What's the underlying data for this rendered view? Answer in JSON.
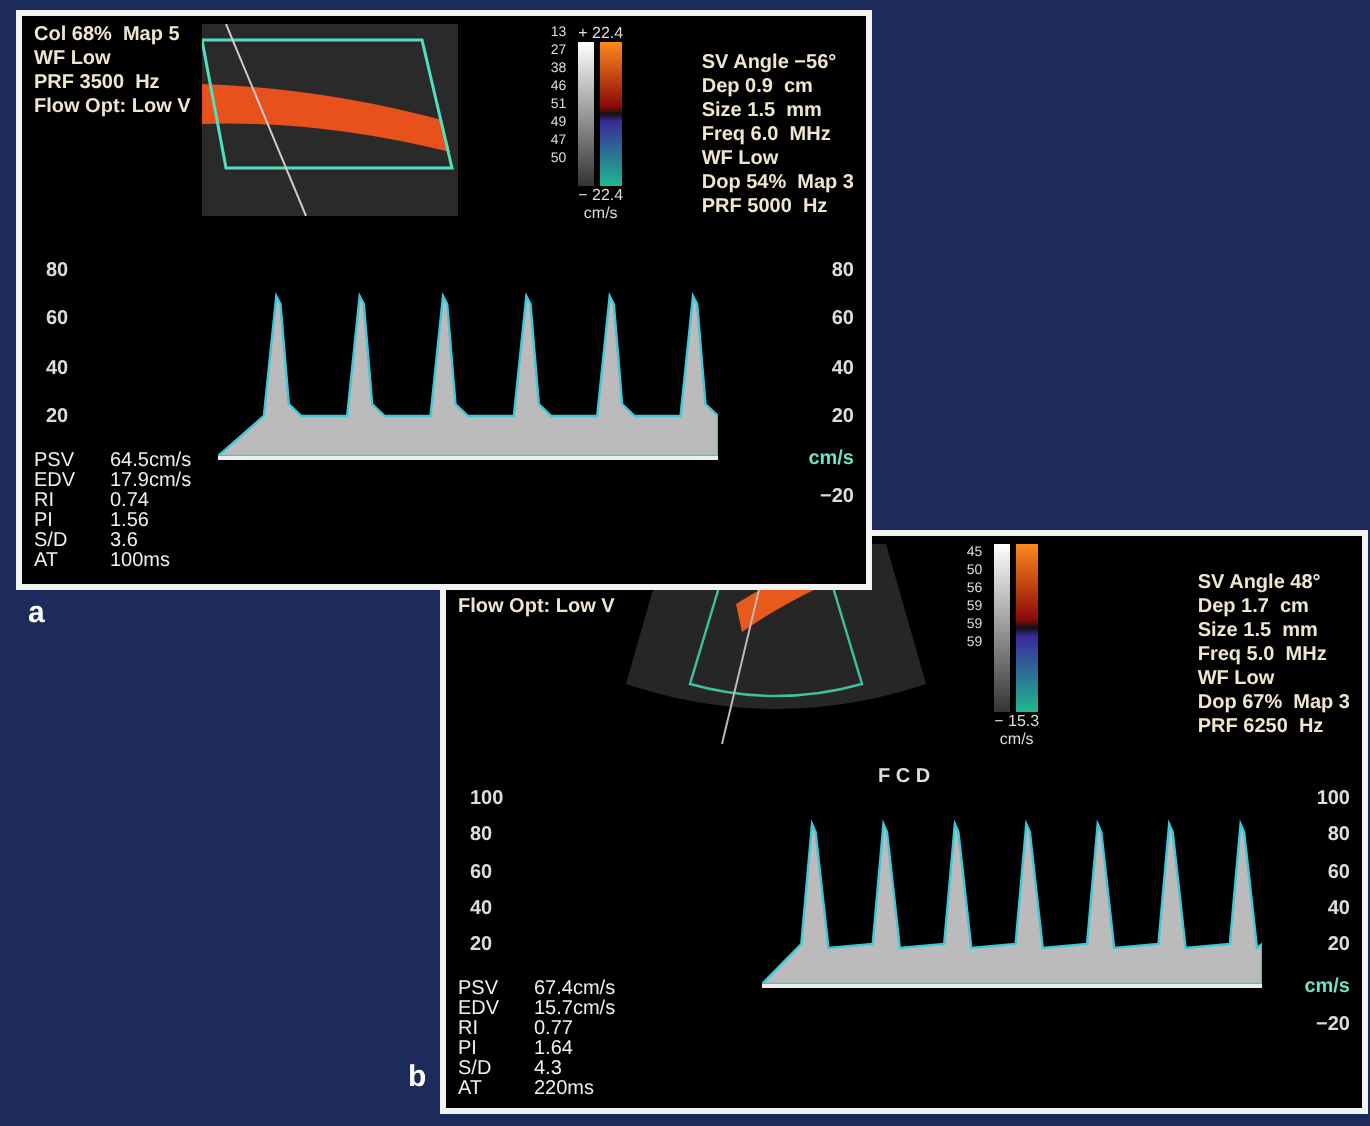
{
  "panels": [
    {
      "label": "a",
      "kind": "linear",
      "color_settings": [
        "Col 68%  Map 5",
        "WF Low",
        "PRF 3500  Hz",
        "Flow Opt: Low V"
      ],
      "depth_marks": [
        "13",
        "27",
        "38",
        "46",
        "51",
        "49",
        "47",
        "50"
      ],
      "color_bar": {
        "top": "+ 22.4",
        "bottom": "− 22.4",
        "unit": "cm/s"
      },
      "doppler_settings": [
        "SV Angle −56°",
        "Dep 0.9  cm",
        "Size 1.5  mm",
        "Freq 6.0  MHz",
        "WF Low",
        "Dop 54%  Map 3",
        "PRF 5000  Hz"
      ],
      "left_scale": [
        "80",
        "60",
        "40",
        "20"
      ],
      "right_scale": [
        "80",
        "60",
        "40",
        "20"
      ],
      "unit": "cm/s",
      "negative_tick": "−20",
      "measurements": [
        {
          "name": "PSV",
          "value": "64.5cm/s"
        },
        {
          "name": "EDV",
          "value": "17.9cm/s"
        },
        {
          "name": "RI",
          "value": "0.74"
        },
        {
          "name": "PI",
          "value": "1.56"
        },
        {
          "name": "S/D",
          "value": "3.6"
        },
        {
          "name": "AT",
          "value": "100ms"
        }
      ]
    },
    {
      "label": "b",
      "kind": "sector",
      "caption": "F C D",
      "color_settings": [
        "Flow Opt: Low V"
      ],
      "depth_marks": [
        "45",
        "50",
        "56",
        "59",
        "59",
        "59"
      ],
      "color_bar": {
        "bottom": "− 15.3",
        "unit": "cm/s"
      },
      "doppler_settings": [
        "SV Angle 48°",
        "Dep 1.7  cm",
        "Size 1.5  mm",
        "Freq 5.0  MHz",
        "WF Low",
        "Dop 67%  Map 3",
        "PRF 6250  Hz"
      ],
      "left_scale": [
        "100",
        "80",
        "60",
        "40",
        "20"
      ],
      "right_scale": [
        "100",
        "80",
        "60",
        "40",
        "20"
      ],
      "unit": "cm/s",
      "negative_tick": "−20",
      "measurements": [
        {
          "name": "PSV",
          "value": "67.4cm/s"
        },
        {
          "name": "EDV",
          "value": "15.7cm/s"
        },
        {
          "name": "RI",
          "value": "0.77"
        },
        {
          "name": "PI",
          "value": "1.64"
        },
        {
          "name": "S/D",
          "value": "4.3"
        },
        {
          "name": "AT",
          "value": "220ms"
        }
      ]
    }
  ]
}
